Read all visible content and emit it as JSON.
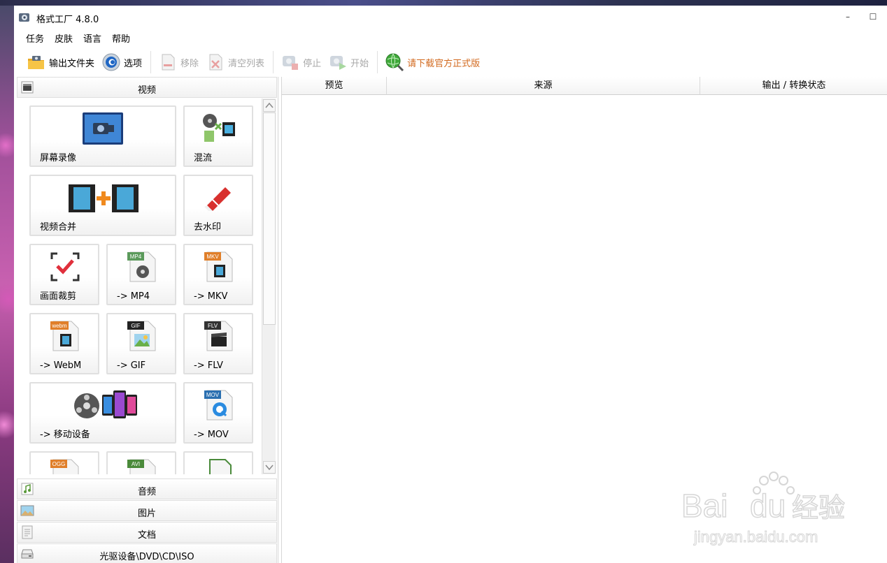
{
  "window": {
    "title": "格式工厂 4.8.0",
    "min_glyph": "–",
    "max_glyph": "☐"
  },
  "menu": [
    "任务",
    "皮肤",
    "语言",
    "帮助"
  ],
  "toolbar": {
    "output_folder": "输出文件夹",
    "options": "选项",
    "remove": "移除",
    "clear_list": "清空列表",
    "stop": "停止",
    "start": "开始",
    "download": "请下载官方正式版",
    "download_color": "#d2691e"
  },
  "categories": {
    "video": "视频",
    "audio": "音频",
    "image": "图片",
    "document": "文档",
    "disc": "光驱设备\\DVD\\CD\\ISO"
  },
  "tiles": {
    "screen_record": "屏幕录像",
    "mux": "混流",
    "merge": "视频合并",
    "remove_watermark": "去水印",
    "crop": "画面裁剪",
    "to_mp4": "-> MP4",
    "to_mkv": "-> MKV",
    "to_webm": "-> WebM",
    "to_gif": "-> GIF",
    "to_flv": "-> FLV",
    "to_mobile": "-> 移动设备",
    "to_mov": "-> MOV"
  },
  "badges": {
    "mp4": "MP4",
    "mkv": "MKV",
    "webm": "webm",
    "gif": "GIF",
    "flv": "FLV",
    "mov": "MOV",
    "ogg": "OGG",
    "avi": "AVI"
  },
  "columns": {
    "preview": "预览",
    "source": "来源",
    "output_status": "输出 / 转换状态"
  },
  "watermark": {
    "brand": "Bai",
    "brand2": "du",
    "jingyan": "经验",
    "url": "jingyan.baidu.com"
  }
}
